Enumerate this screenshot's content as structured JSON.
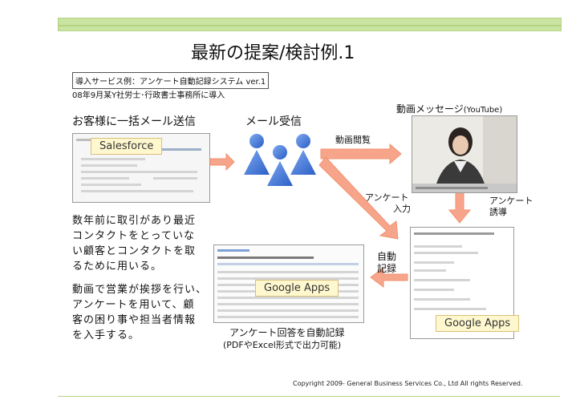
{
  "title": "最新の提案/検討例.1",
  "intro": {
    "line1": "導入サービス例：アンケート自動記録システム ver.1",
    "line2": "08年9月某Y社労士･行政書士事務所に導入"
  },
  "steps": {
    "bulk_mail": "お客様に一括メール送信",
    "mail_receive": "メール受信",
    "video_view": "動画閲覧",
    "video_message_prefix": "動画メッセージ",
    "video_message_suffix": "(YouTube)",
    "survey_input_1": "アンケート",
    "survey_input_2": "入力",
    "survey_guide_1": "アンケート",
    "survey_guide_2": "誘導",
    "auto_record_1": "自動",
    "auto_record_2": "記録",
    "auto_record_note_1": "アンケート回答を自動記録",
    "auto_record_note_2": "(PDFやExcel形式で出力可能)"
  },
  "labels": {
    "salesforce": "Salesforce",
    "google_apps": "Google Apps",
    "google_apps_form": "Google Apps"
  },
  "description": {
    "lines_a": [
      "数年前に取引があり最近",
      "コンタクトをとっていな",
      "い顧客とコンタクトを取",
      "るために用いる。"
    ],
    "lines_b": [
      "動画で営業が挨拶を行い、",
      "アンケートを用いて、顧",
      "客の困り事や担当者情報",
      "を入手する。"
    ]
  },
  "footer": "Copyright 2009- General Business Services Co., Ltd All rights Reserved.",
  "colors": {
    "accent_green": "#c9e3a1",
    "arrow_orange": "#f7a58a",
    "person_blue": "#3a6fd0"
  }
}
